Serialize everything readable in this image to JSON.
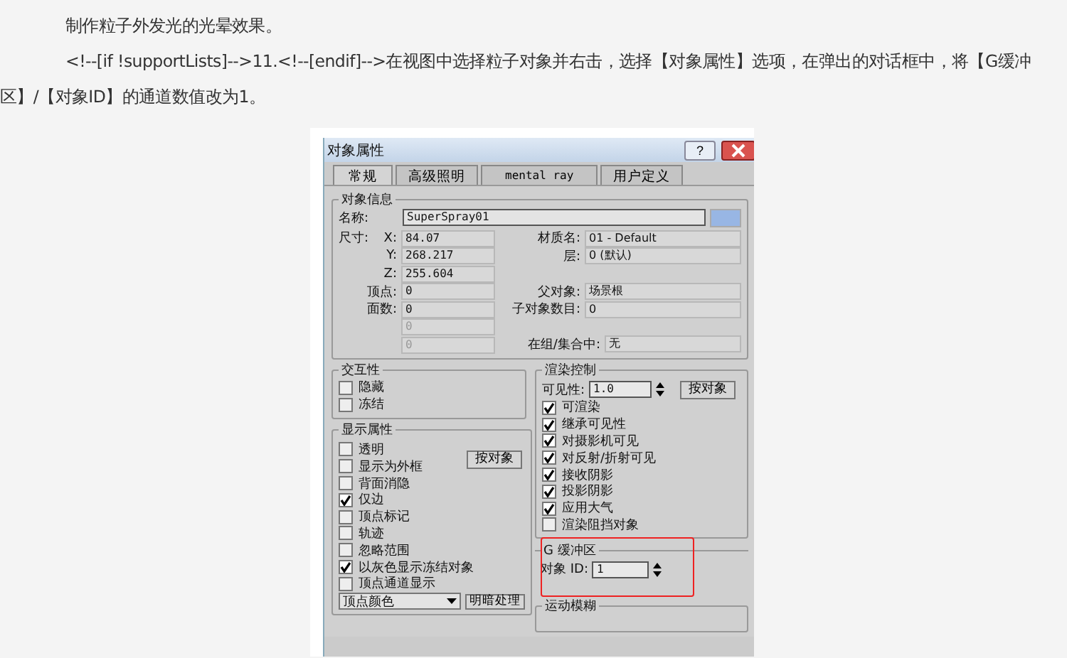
{
  "paragraphs": [
    "制作粒子外发光的光晕效果。",
    "<!--[if !supportLists]-->11.<!--[endif]-->在视图中选择粒子对象并右击，选择【对象属性】选项，在弹出的对话框中，将【G缓冲区】/【对象ID】的通道数值改为1。"
  ],
  "dialog": {
    "title": "对象属性",
    "help": "?",
    "tabs": [
      {
        "label": "常规",
        "selected": true
      },
      {
        "label": "高级照明",
        "selected": false
      },
      {
        "label": "mental ray",
        "selected": false
      },
      {
        "label": "用户定义",
        "selected": false
      }
    ],
    "object_info": {
      "title": "对象信息",
      "name_label": "名称:",
      "name_value": "SuperSpray01",
      "size_label": "尺寸:",
      "dims": [
        {
          "label": "X:",
          "value": "84.07"
        },
        {
          "label": "Y:",
          "value": "268.217"
        },
        {
          "label": "Z:",
          "value": "255.604"
        }
      ],
      "counts": [
        {
          "label": "顶点:",
          "value": "0",
          "disabled": false
        },
        {
          "label": "面数:",
          "value": "0",
          "disabled": false
        },
        {
          "value": "0",
          "disabled": true
        },
        {
          "value": "0",
          "disabled": true
        }
      ],
      "props": [
        {
          "label": "材质名:",
          "value": "01 - Default"
        },
        {
          "label": "层:",
          "value": "0 (默认)"
        }
      ],
      "hier": [
        {
          "label": "父对象:",
          "value": "场景根"
        },
        {
          "label": "子对象数目:",
          "value": "0"
        }
      ],
      "group_label": "在组/集合中:",
      "group_value": "无"
    },
    "interactivity": {
      "title": "交互性",
      "options": [
        {
          "label": "隐藏",
          "checked": false
        },
        {
          "label": "冻结",
          "checked": false
        }
      ]
    },
    "display": {
      "title": "显示属性",
      "button": "按对象",
      "options": [
        {
          "label": "透明",
          "checked": false
        },
        {
          "label": "显示为外框",
          "checked": false
        },
        {
          "label": "背面消隐",
          "checked": false
        },
        {
          "label": "仅边",
          "checked": true
        },
        {
          "label": "顶点标记",
          "checked": false
        },
        {
          "label": "轨迹",
          "checked": false
        },
        {
          "label": "忽略范围",
          "checked": false
        },
        {
          "label": "以灰色显示冻结对象",
          "checked": true
        },
        {
          "label": "顶点通道显示",
          "checked": false
        }
      ],
      "dropdown": "顶点颜色",
      "shading_button": "明暗处理"
    },
    "render": {
      "title": "渲染控制",
      "visibility_label": "可见性:",
      "visibility_value": "1.0",
      "button": "按对象",
      "options": [
        {
          "label": "可渲染",
          "checked": true
        },
        {
          "label": "继承可见性",
          "checked": true
        },
        {
          "label": "对摄影机可见",
          "checked": true
        },
        {
          "label": "对反射/折射可见",
          "checked": true
        },
        {
          "label": "接收阴影",
          "checked": true
        },
        {
          "label": "投影阴影",
          "checked": true
        },
        {
          "label": "应用大气",
          "checked": true
        },
        {
          "label": "渲染阻挡对象",
          "checked": false
        }
      ]
    },
    "gbuffer": {
      "title": "G 缓冲区",
      "label": "对象 ID:",
      "value": "1",
      "highlighted": true
    },
    "motion_blur": {
      "title": "运动模糊"
    }
  }
}
